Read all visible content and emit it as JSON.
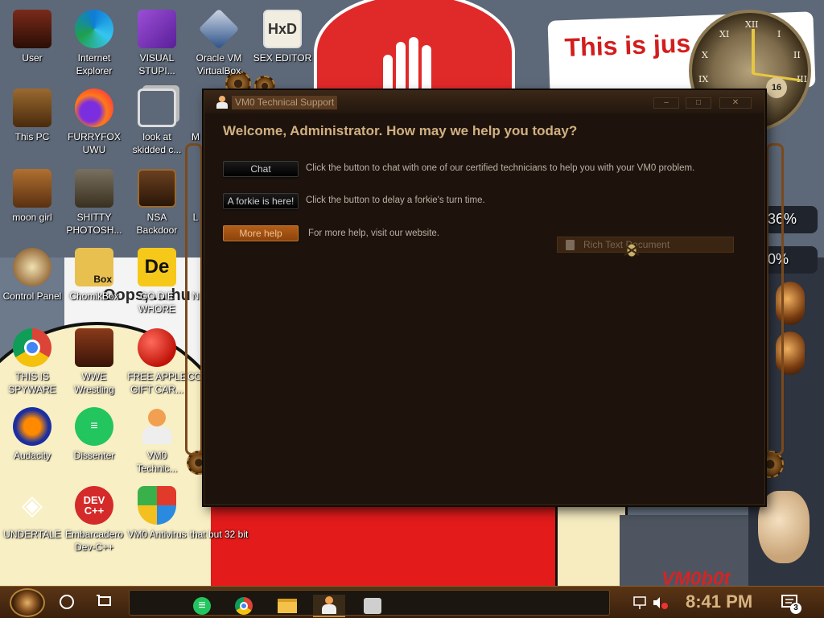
{
  "desktop": {
    "icons": [
      {
        "label": "User",
        "icon": "user-folder-icon"
      },
      {
        "label": "Internet Explorer",
        "icon": "edge-icon"
      },
      {
        "label": "VISUAL STUPI...",
        "icon": "visual-studio-icon"
      },
      {
        "label": "Oracle VM VirtualBox",
        "icon": "virtualbox-icon"
      },
      {
        "label": "SEX EDITOR",
        "icon": "hex-editor-icon"
      },
      {
        "label": "This PC",
        "icon": "computer-icon"
      },
      {
        "label": "FURRYFOX UWU",
        "icon": "firefox-icon"
      },
      {
        "label": "look at skidded c...",
        "icon": "copy-icon"
      },
      {
        "label": "moon girl",
        "icon": "folder-icon"
      },
      {
        "label": "SHITTY PHOTOSH...",
        "icon": "gimp-icon"
      },
      {
        "label": "NSA Backdoor",
        "icon": "backdoor-icon"
      },
      {
        "label": "Control Panel",
        "icon": "control-panel-icon"
      },
      {
        "label": "ChomikBox",
        "icon": "chomikbox-icon"
      },
      {
        "label": "GO DIE WHORE",
        "icon": "de-app-icon"
      },
      {
        "label": "THIS IS SPYWARE",
        "icon": "chrome-icon"
      },
      {
        "label": "WWE Wrestling",
        "icon": "oven-icon"
      },
      {
        "label": "FREE APPLE GIFT CAR...",
        "icon": "apple-icon"
      },
      {
        "label": "Audacity",
        "icon": "audacity-icon"
      },
      {
        "label": "Dissenter",
        "icon": "dissenter-icon"
      },
      {
        "label": "VM0 Technic...",
        "icon": "technician-icon"
      },
      {
        "label": "UNDERTALE",
        "icon": "unity-icon"
      },
      {
        "label": "Embarcadero Dev-C++",
        "icon": "devcpp-icon"
      },
      {
        "label": "VM0 Antivirus",
        "icon": "shield-icon"
      },
      {
        "label": "that but 32 bit",
        "icon": "app-icon"
      }
    ],
    "partial_labels": {
      "m": "M",
      "l": "L",
      "n": "N",
      "co": "CO"
    }
  },
  "wallpaper": {
    "poster_text": "This is jus George O",
    "percent_top": "36%",
    "percent_bottom": "0%",
    "faded_text": "Oops, ... hu",
    "vmobot": "VM0b0t",
    "clock": {
      "numerals": [
        "XII",
        "I",
        "II",
        "III",
        "IX",
        "X",
        "XI"
      ],
      "dial_value": "16"
    }
  },
  "dialog": {
    "title": "VM0 Technical Support",
    "welcome": "Welcome, Administrator. How may we help you today?",
    "buttons": [
      {
        "label": "Chat",
        "description": "Click the button to chat with one of our certified technicians to help you with your VM0 problem."
      },
      {
        "label": "A forkie is here!",
        "description": "Click the button to delay a forkie's turn time."
      },
      {
        "label": "More help",
        "description": "For more help, visit our website."
      }
    ],
    "drag_item": "Rich Text Document",
    "window_buttons": [
      "minimize-button",
      "maximize-button",
      "close-button"
    ]
  },
  "taskbar": {
    "time": "8:41 PM",
    "notification_count": "3",
    "pinned": [
      "dissenter",
      "chrome",
      "file-explorer",
      "technician",
      "support-app"
    ]
  },
  "colors": {
    "dialog_bg": "#1d130c",
    "accent": "#d2b082",
    "orange_button": "#b35e18",
    "taskbar": "#4a2a10"
  }
}
